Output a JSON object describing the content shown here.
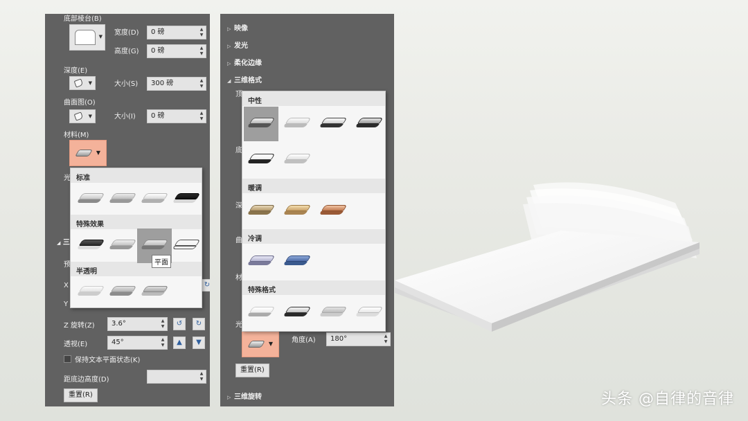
{
  "left_panel": {
    "bevel_bottom_label": "底部棱台(B)",
    "width_label": "宽度(D)",
    "width_value": "0 磅",
    "height_label": "高度(G)",
    "height_value": "0 磅",
    "depth_label": "深度(E)",
    "depth_size_label": "大小(S)",
    "depth_size_value": "300 磅",
    "contour_label": "曲面图(O)",
    "contour_size_label": "大小(I)",
    "contour_size_value": "0 磅",
    "material_label": "材料(M)",
    "lighting_partial": "光",
    "rotation_partial": "三",
    "preset_partial": "预",
    "x_partial": "X",
    "y_partial": "Y",
    "z_rotation_label": "Z 旋转(Z)",
    "z_rotation_value": "3.6°",
    "perspective_label": "透视(E)",
    "perspective_value": "45°",
    "keep_text_flat_label": "保持文本平面状态(K)",
    "distance_label": "距底边高度(D)",
    "distance_value": "",
    "reset_label": "重置(R)"
  },
  "left_gallery": {
    "sections": [
      {
        "title": "标准",
        "count": 4
      },
      {
        "title": "特殊效果",
        "count": 4
      },
      {
        "title": "半透明",
        "count": 3
      }
    ],
    "tooltip": "平面"
  },
  "right_panel": {
    "sections": [
      "映像",
      "发光",
      "柔化边缘",
      "三维格式"
    ],
    "partial_1": "顶",
    "partial_2": "底",
    "partial_3": "深",
    "partial_4": "曲",
    "partial_5": "材",
    "partial_6": "光",
    "angle_label": "角度(A)",
    "angle_value": "180°",
    "reset_label": "重置(R)",
    "rotation_section": "三维旋转"
  },
  "right_gallery": {
    "sections": [
      {
        "title": "中性"
      },
      {
        "title": "暖调"
      },
      {
        "title": "冷调"
      },
      {
        "title": "特殊格式"
      }
    ]
  },
  "watermark": "头条 @自律的音律",
  "icons": {
    "collapsed": "triangle-right-icon",
    "expanded": "triangle-down-icon"
  },
  "colors": {
    "panel_bg": "#616161",
    "material_button": "#f4b29a",
    "gallery_bg": "#f6f6f6",
    "selected_tile": "#9e9e9e"
  }
}
